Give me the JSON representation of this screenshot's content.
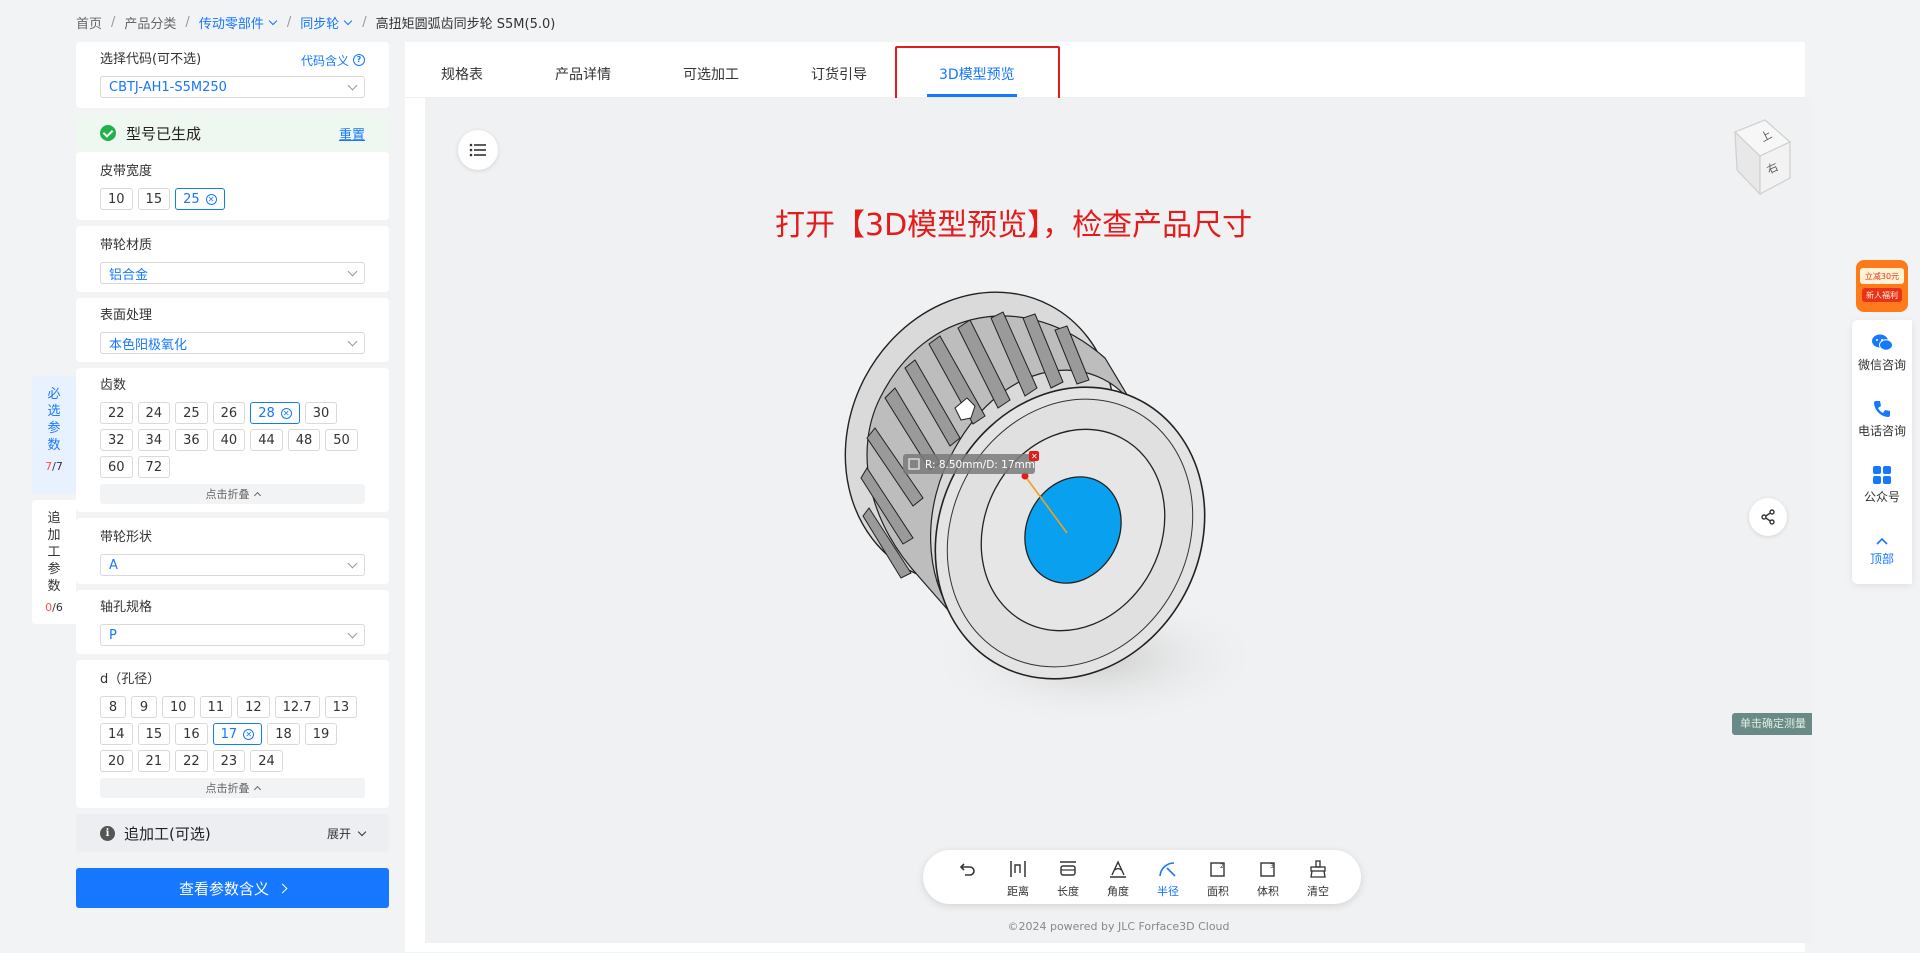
{
  "breadcrumb": {
    "home": "首页",
    "category": "产品分类",
    "transmission": "传动零部件",
    "sync_wheel": "同步轮",
    "current": "高扭矩圆弧齿同步轮 S5M(5.0)"
  },
  "code_select": {
    "label": "选择代码(可不选)",
    "meaning_link": "代码含义",
    "value": "CBTJ-AH1-S5M250"
  },
  "generated": {
    "label": "型号已生成",
    "reset": "重置"
  },
  "belt_width": {
    "label": "皮带宽度",
    "options": [
      "10",
      "15",
      "25"
    ],
    "selected": "25"
  },
  "material": {
    "label": "带轮材质",
    "value": "铝合金"
  },
  "surface": {
    "label": "表面处理",
    "value": "本色阳极氧化"
  },
  "teeth": {
    "label": "齿数",
    "options": [
      "22",
      "24",
      "25",
      "26",
      "28",
      "30",
      "32",
      "34",
      "36",
      "40",
      "44",
      "48",
      "50",
      "60",
      "72"
    ],
    "selected": "28",
    "fold": "点击折叠"
  },
  "shape": {
    "label": "带轮形状",
    "value": "A"
  },
  "bore_spec": {
    "label": "轴孔规格",
    "value": "P"
  },
  "bore_d": {
    "label": "d（孔径）",
    "options": [
      "8",
      "9",
      "10",
      "11",
      "12",
      "12.7",
      "13",
      "14",
      "15",
      "16",
      "17",
      "18",
      "19",
      "20",
      "21",
      "22",
      "23",
      "24"
    ],
    "selected": "17",
    "fold": "点击折叠"
  },
  "extra_processing": {
    "label": "追加工(可选)",
    "expand": "展开"
  },
  "view_meaning_button": "查看参数含义",
  "side_tabs": {
    "required": {
      "text": [
        "必",
        "选",
        "参",
        "数"
      ],
      "done": "7",
      "total": "/7"
    },
    "extra": {
      "text": [
        "追",
        "加",
        "工",
        "参",
        "数"
      ],
      "done": "0",
      "total": "/6"
    }
  },
  "tabs": [
    "规格表",
    "产品详情",
    "可选加工",
    "订货引导",
    "3D模型预览"
  ],
  "active_tab": "3D模型预览",
  "annotation": "打开【3D模型预览】，检查产品尺寸",
  "measurement_label": "R: 8.50mm/D: 17mm",
  "view_cube": {
    "top": "上",
    "right": "右"
  },
  "measure_tag": "单击确定测量",
  "toolbar": [
    {
      "name": "undo",
      "label": ""
    },
    {
      "name": "distance",
      "label": "距离"
    },
    {
      "name": "length",
      "label": "长度"
    },
    {
      "name": "angle",
      "label": "角度"
    },
    {
      "name": "radius",
      "label": "半径"
    },
    {
      "name": "area",
      "label": "面积"
    },
    {
      "name": "volume",
      "label": "体积"
    },
    {
      "name": "clear",
      "label": "清空"
    }
  ],
  "copyright": "©2024 powered by JLC Forface3D Cloud",
  "float_bar": {
    "promo_line1": "立减30元",
    "promo_line2": "新人福利",
    "wechat": "微信咨询",
    "phone": "电话咨询",
    "official": "公众号",
    "top": "顶部"
  },
  "colors": {
    "accent": "#1677ff",
    "highlight": "#e41b1b",
    "bore": "#0aa0f0",
    "success": "#22b14c"
  }
}
